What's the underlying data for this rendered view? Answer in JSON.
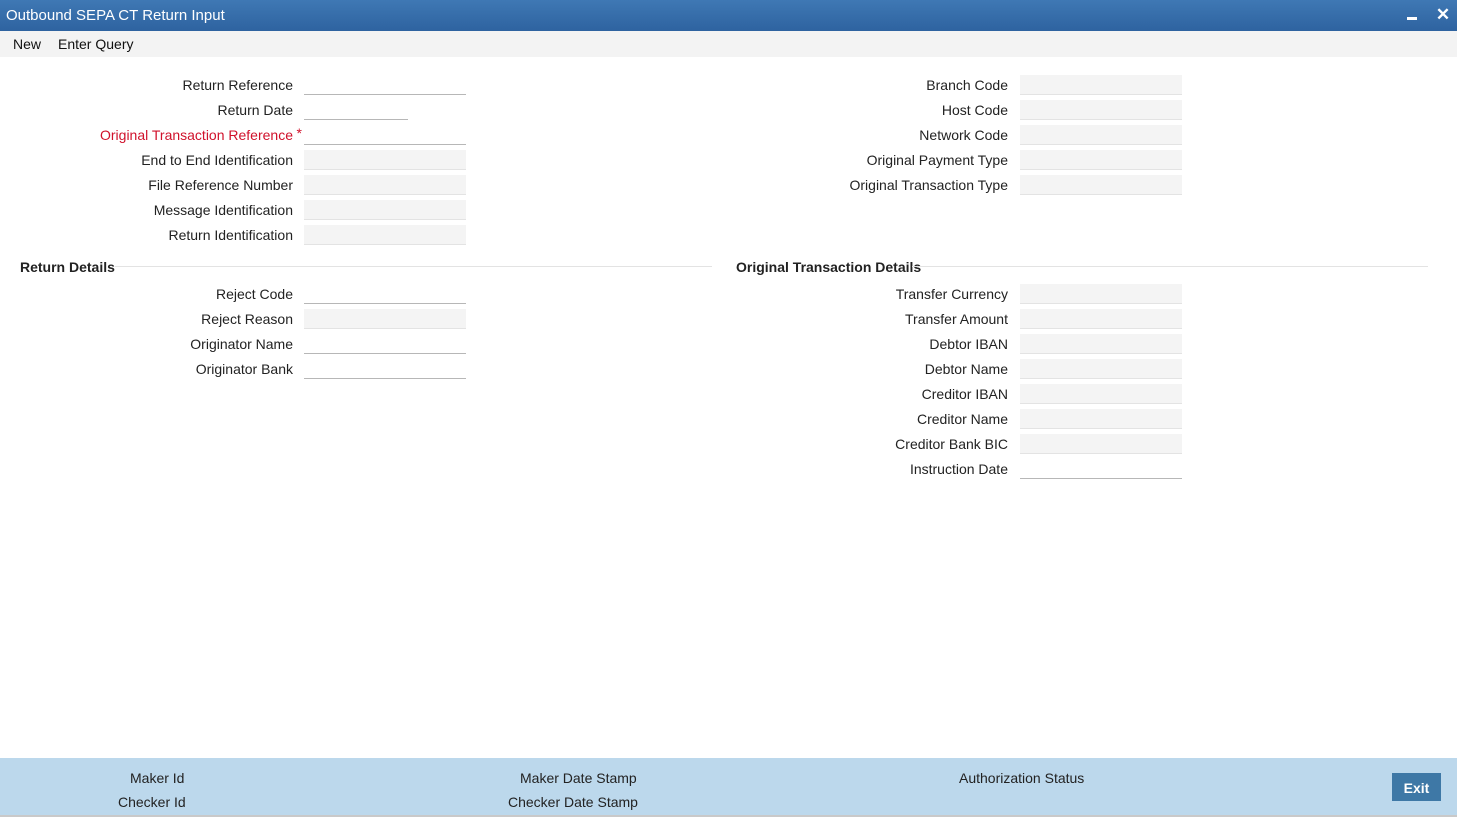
{
  "window": {
    "title": "Outbound SEPA CT Return Input"
  },
  "menu": {
    "new": "New",
    "enter_query": "Enter Query"
  },
  "main": {
    "return_reference": "Return Reference",
    "return_date": "Return Date",
    "original_transaction_reference": "Original Transaction Reference",
    "end_to_end_identification": "End to End Identification",
    "file_reference_number": "File Reference Number",
    "message_identification": "Message Identification",
    "return_identification": "Return Identification",
    "branch_code": "Branch Code",
    "host_code": "Host Code",
    "network_code": "Network Code",
    "original_payment_type": "Original Payment Type",
    "original_transaction_type": "Original Transaction Type"
  },
  "return_details": {
    "title": "Return Details",
    "reject_code": "Reject Code",
    "reject_reason": "Reject Reason",
    "originator_name": "Originator Name",
    "originator_bank": "Originator Bank"
  },
  "original_transaction_details": {
    "title": "Original Transaction Details",
    "transfer_currency": "Transfer Currency",
    "transfer_amount": "Transfer Amount",
    "debtor_iban": "Debtor IBAN",
    "debtor_name": "Debtor Name",
    "creditor_iban": "Creditor IBAN",
    "creditor_name": "Creditor Name",
    "creditor_bank_bic": "Creditor Bank BIC",
    "instruction_date": "Instruction Date"
  },
  "footer": {
    "maker_id": "Maker Id",
    "checker_id": "Checker Id",
    "maker_date_stamp": "Maker Date Stamp",
    "checker_date_stamp": "Checker Date Stamp",
    "authorization_status": "Authorization Status",
    "exit": "Exit"
  }
}
